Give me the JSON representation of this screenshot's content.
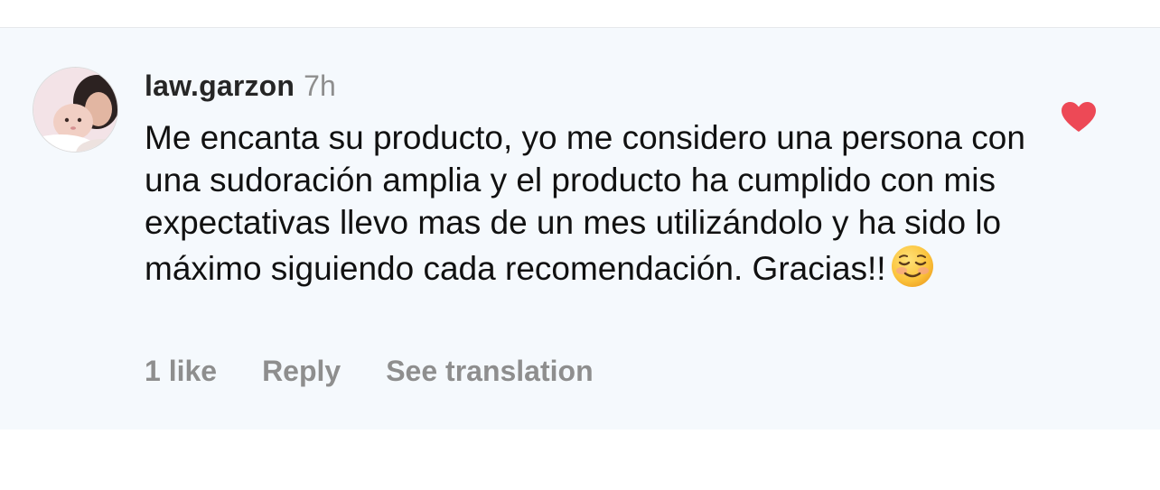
{
  "comment": {
    "username": "law.garzon",
    "time": "7h",
    "text": "Me encanta su producto, yo me considero una persona con una sudoración amplia y el producto ha cumplido con mis expectativas llevo mas de un mes utilizándolo y ha sido lo máximo siguiendo cada recomendación. Gracias!!",
    "emoji_icon": "smiling-face-icon",
    "liked": true,
    "heart_color": "#ed4956"
  },
  "actions": {
    "likes_label": "1 like",
    "reply_label": "Reply",
    "translate_label": "See translation"
  }
}
